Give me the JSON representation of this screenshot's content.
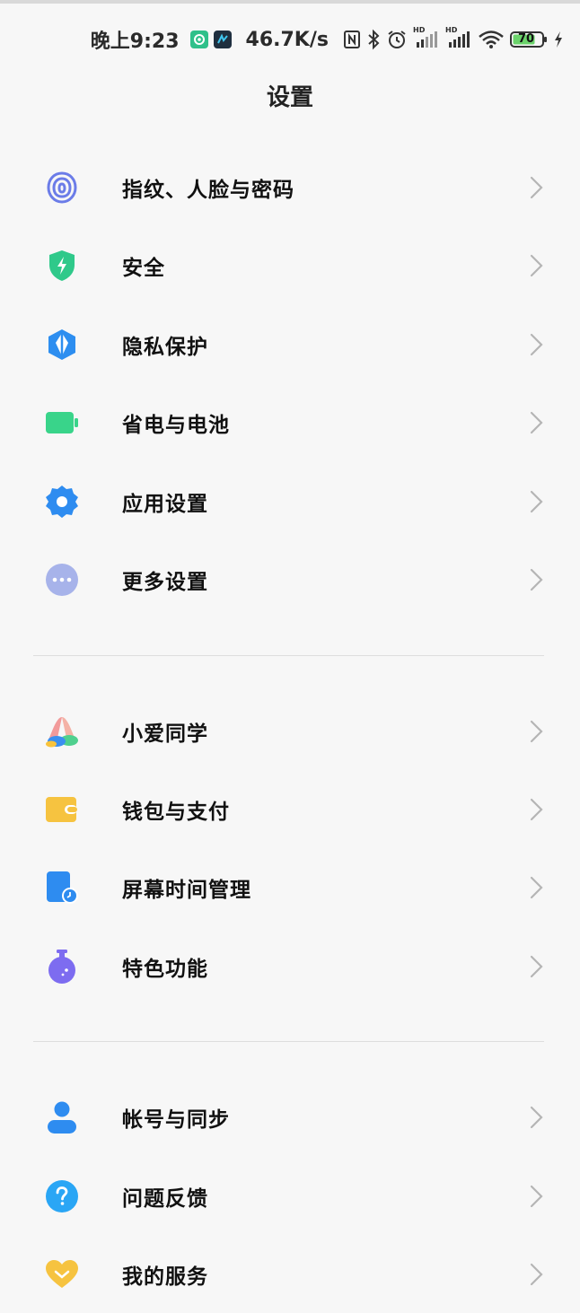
{
  "status_bar": {
    "time": "晚上9:23",
    "net_speed": "46.7K/s",
    "battery": "70",
    "hd1": "HD",
    "hd2": "HD"
  },
  "header": {
    "title": "设置"
  },
  "groups": [
    {
      "items": [
        {
          "label": "指纹、人脸与密码",
          "icon": "fingerprint-icon",
          "color": "#6b7ce8"
        },
        {
          "label": "安全",
          "icon": "shield-icon",
          "color": "#2fc98a"
        },
        {
          "label": "隐私保护",
          "icon": "privacy-icon",
          "color": "#2d8ef0"
        },
        {
          "label": "省电与电池",
          "icon": "battery-icon",
          "color": "#39d48a"
        },
        {
          "label": "应用设置",
          "icon": "gear-icon",
          "color": "#2e8cf0"
        },
        {
          "label": "更多设置",
          "icon": "more-icon",
          "color": "#a7b3ea"
        }
      ]
    },
    {
      "items": [
        {
          "label": "小爱同学",
          "icon": "xiaoai-icon",
          "color": "#f29a9a"
        },
        {
          "label": "钱包与支付",
          "icon": "wallet-icon",
          "color": "#f6c340"
        },
        {
          "label": "屏幕时间管理",
          "icon": "screen-time-icon",
          "color": "#2e8cf0"
        },
        {
          "label": "特色功能",
          "icon": "flask-icon",
          "color": "#7d6cf0"
        }
      ]
    },
    {
      "items": [
        {
          "label": "帐号与同步",
          "icon": "account-icon",
          "color": "#2e8cf0"
        },
        {
          "label": "问题反馈",
          "icon": "feedback-icon",
          "color": "#2aa6f5"
        },
        {
          "label": "我的服务",
          "icon": "heart-icon",
          "color": "#f6c340"
        }
      ]
    }
  ]
}
